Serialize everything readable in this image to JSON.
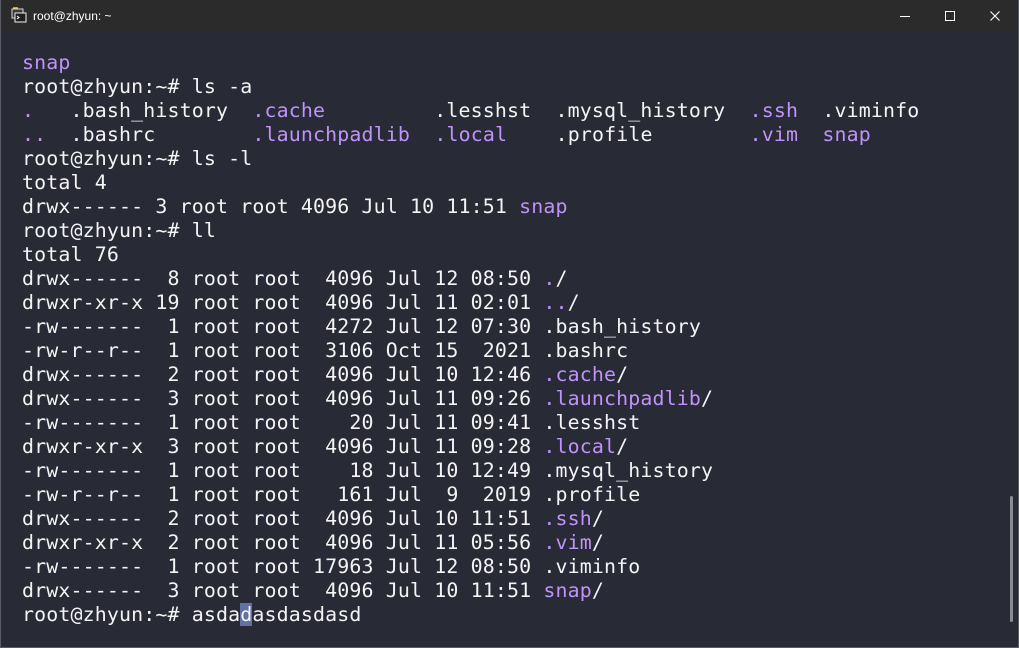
{
  "window": {
    "title": "root@zhyun: ~",
    "colors": {
      "titlebar_bg": "#2b2b2b",
      "terminal_bg": "#282a35",
      "text": "#f4f4f4",
      "directory": "#bf93f9",
      "cursor": "#6271a4"
    },
    "icons": {
      "app": "terminal-app-icon",
      "minimize": "minimize-icon",
      "maximize": "maximize-icon",
      "close": "close-icon"
    }
  },
  "terminal": {
    "lines": [
      {
        "segments": [
          {
            "text": "snap",
            "style": "dir"
          }
        ]
      },
      {
        "segments": [
          {
            "text": "root@zhyun:~# ls -a",
            "style": "normal"
          }
        ]
      },
      {
        "segments": [
          {
            "text": ".",
            "style": "dir"
          },
          {
            "text": "   .bash_history  ",
            "style": "normal"
          },
          {
            "text": ".cache",
            "style": "dir"
          },
          {
            "text": "         .lesshst  .mysql_history  ",
            "style": "normal"
          },
          {
            "text": ".ssh",
            "style": "dir"
          },
          {
            "text": "  .viminfo",
            "style": "normal"
          }
        ]
      },
      {
        "segments": [
          {
            "text": "..",
            "style": "dir"
          },
          {
            "text": "  .bashrc        ",
            "style": "normal"
          },
          {
            "text": ".launchpadlib",
            "style": "dir"
          },
          {
            "text": "  ",
            "style": "normal"
          },
          {
            "text": ".local",
            "style": "dir"
          },
          {
            "text": "    .profile        ",
            "style": "normal"
          },
          {
            "text": ".vim",
            "style": "dir"
          },
          {
            "text": "  ",
            "style": "normal"
          },
          {
            "text": "snap",
            "style": "dir"
          }
        ]
      },
      {
        "segments": [
          {
            "text": "root@zhyun:~# ls -l",
            "style": "normal"
          }
        ]
      },
      {
        "segments": [
          {
            "text": "total 4",
            "style": "normal"
          }
        ]
      },
      {
        "segments": [
          {
            "text": "drwx------ 3 root root 4096 Jul 10 11:51 ",
            "style": "normal"
          },
          {
            "text": "snap",
            "style": "dir"
          }
        ]
      },
      {
        "segments": [
          {
            "text": "root@zhyun:~# ll",
            "style": "normal"
          }
        ]
      },
      {
        "segments": [
          {
            "text": "total 76",
            "style": "normal"
          }
        ]
      },
      {
        "segments": [
          {
            "text": "drwx------  8 root root  4096 Jul 12 08:50 ",
            "style": "normal"
          },
          {
            "text": ".",
            "style": "dir"
          },
          {
            "text": "/",
            "style": "normal"
          }
        ]
      },
      {
        "segments": [
          {
            "text": "drwxr-xr-x 19 root root  4096 Jul 11 02:01 ",
            "style": "normal"
          },
          {
            "text": "..",
            "style": "dir"
          },
          {
            "text": "/",
            "style": "normal"
          }
        ]
      },
      {
        "segments": [
          {
            "text": "-rw-------  1 root root  4272 Jul 12 07:30 .bash_history",
            "style": "normal"
          }
        ]
      },
      {
        "segments": [
          {
            "text": "-rw-r--r--  1 root root  3106 Oct 15  2021 .bashrc",
            "style": "normal"
          }
        ]
      },
      {
        "segments": [
          {
            "text": "drwx------  2 root root  4096 Jul 10 12:46 ",
            "style": "normal"
          },
          {
            "text": ".cache",
            "style": "dir"
          },
          {
            "text": "/",
            "style": "normal"
          }
        ]
      },
      {
        "segments": [
          {
            "text": "drwx------  3 root root  4096 Jul 11 09:26 ",
            "style": "normal"
          },
          {
            "text": ".launchpadlib",
            "style": "dir"
          },
          {
            "text": "/",
            "style": "normal"
          }
        ]
      },
      {
        "segments": [
          {
            "text": "-rw-------  1 root root    20 Jul 11 09:41 .lesshst",
            "style": "normal"
          }
        ]
      },
      {
        "segments": [
          {
            "text": "drwxr-xr-x  3 root root  4096 Jul 11 09:28 ",
            "style": "normal"
          },
          {
            "text": ".local",
            "style": "dir"
          },
          {
            "text": "/",
            "style": "normal"
          }
        ]
      },
      {
        "segments": [
          {
            "text": "-rw-------  1 root root    18 Jul 10 12:49 .mysql_history",
            "style": "normal"
          }
        ]
      },
      {
        "segments": [
          {
            "text": "-rw-r--r--  1 root root   161 Jul  9  2019 .profile",
            "style": "normal"
          }
        ]
      },
      {
        "segments": [
          {
            "text": "drwx------  2 root root  4096 Jul 10 11:51 ",
            "style": "normal"
          },
          {
            "text": ".ssh",
            "style": "dir"
          },
          {
            "text": "/",
            "style": "normal"
          }
        ]
      },
      {
        "segments": [
          {
            "text": "drwxr-xr-x  2 root root  4096 Jul 11 05:56 ",
            "style": "normal"
          },
          {
            "text": ".vim",
            "style": "dir"
          },
          {
            "text": "/",
            "style": "normal"
          }
        ]
      },
      {
        "segments": [
          {
            "text": "-rw-------  1 root root 17963 Jul 12 08:50 .viminfo",
            "style": "normal"
          }
        ]
      },
      {
        "segments": [
          {
            "text": "drwx------  3 root root  4096 Jul 10 11:51 ",
            "style": "normal"
          },
          {
            "text": "snap",
            "style": "dir"
          },
          {
            "text": "/",
            "style": "normal"
          }
        ]
      },
      {
        "segments": [
          {
            "text": "root@zhyun:~# asda",
            "style": "normal"
          },
          {
            "text": "d",
            "style": "cursor"
          },
          {
            "text": "asdasdasd",
            "style": "normal"
          }
        ]
      }
    ]
  }
}
